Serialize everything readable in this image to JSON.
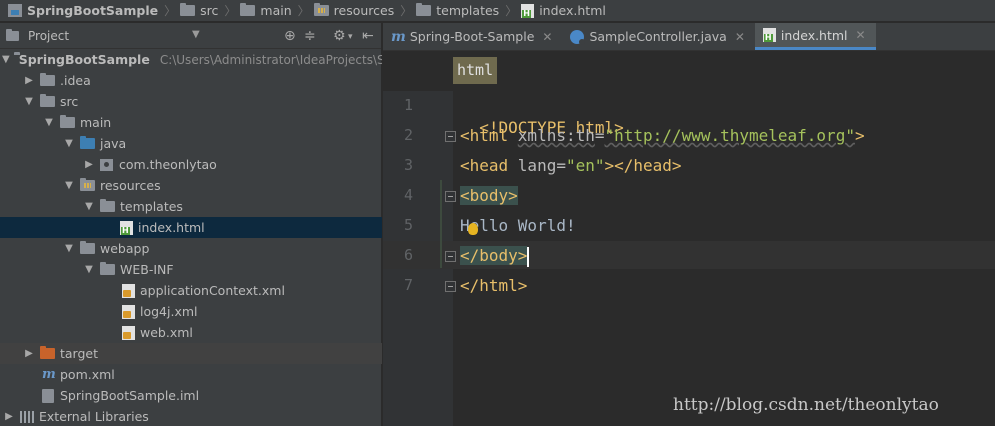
{
  "breadcrumb": [
    {
      "label": "SpringBootSample",
      "icon": "project-icon"
    },
    {
      "label": "src",
      "icon": "folder-icon"
    },
    {
      "label": "main",
      "icon": "folder-icon"
    },
    {
      "label": "resources",
      "icon": "resources-folder-icon"
    },
    {
      "label": "templates",
      "icon": "folder-icon"
    },
    {
      "label": "index.html",
      "icon": "html-file-icon"
    }
  ],
  "project_panel": {
    "title": "Project",
    "toolbar_icons": [
      "locate-icon",
      "collapse-all-icon",
      "settings-icon",
      "hide-icon"
    ]
  },
  "tree": [
    {
      "label": "SpringBootSample",
      "path": "C:\\Users\\Administrator\\IdeaProjects\\S",
      "icon": "module-folder-icon",
      "expanded": true
    },
    {
      "label": ".idea",
      "icon": "folder-icon",
      "expanded": false
    },
    {
      "label": "src",
      "icon": "folder-icon",
      "expanded": true
    },
    {
      "label": "main",
      "icon": "folder-icon",
      "expanded": true
    },
    {
      "label": "java",
      "icon": "source-folder-icon",
      "expanded": true
    },
    {
      "label": "com.theonlytao",
      "icon": "package-icon",
      "expanded": false
    },
    {
      "label": "resources",
      "icon": "resources-folder-icon",
      "expanded": true
    },
    {
      "label": "templates",
      "icon": "folder-icon",
      "expanded": true
    },
    {
      "label": "index.html",
      "icon": "html-file-icon",
      "selected": true
    },
    {
      "label": "webapp",
      "icon": "folder-icon",
      "expanded": true
    },
    {
      "label": "WEB-INF",
      "icon": "folder-icon",
      "expanded": true
    },
    {
      "label": "applicationContext.xml",
      "icon": "xml-file-icon"
    },
    {
      "label": "log4j.xml",
      "icon": "xml-file-icon"
    },
    {
      "label": "web.xml",
      "icon": "xml-file-icon"
    },
    {
      "label": "target",
      "icon": "excluded-folder-icon",
      "expanded": false
    },
    {
      "label": "pom.xml",
      "icon": "maven-icon"
    },
    {
      "label": "SpringBootSample.iml",
      "icon": "iml-file-icon"
    },
    {
      "label": "External Libraries",
      "icon": "libraries-icon",
      "expanded": false
    }
  ],
  "tabs": [
    {
      "label": "Spring-Boot-Sample",
      "icon": "maven-icon",
      "active": false
    },
    {
      "label": "SampleController.java",
      "icon": "java-class-icon",
      "active": false
    },
    {
      "label": "index.html",
      "icon": "html-file-icon",
      "active": true
    }
  ],
  "editor": {
    "tag_breadcrumb": "html",
    "line_numbers": [
      "1",
      "2",
      "3",
      "4",
      "5",
      "6",
      "7"
    ],
    "lines": [
      {
        "doctype": "<!DOCTYPE html>"
      },
      {
        "open": "<html ",
        "attr": "xmlns:th",
        "eq": "=",
        "value": "\"http://www.thymeleaf.org\"",
        "close": ">"
      },
      {
        "open": "<head ",
        "attr": "lang",
        "eq": "=",
        "value": "\"en\"",
        "close": "></head>"
      },
      {
        "tag": "<body>"
      },
      {
        "text": "Hello World!"
      },
      {
        "tag": "</body>"
      },
      {
        "tag": "</html>"
      }
    ]
  },
  "watermark": "http://blog.csdn.net/theonlytao",
  "colors": {
    "tag": "#e8bf6a",
    "string": "#a5c25c",
    "selection": "#0d293e",
    "tab_accent": "#4a88c7"
  }
}
